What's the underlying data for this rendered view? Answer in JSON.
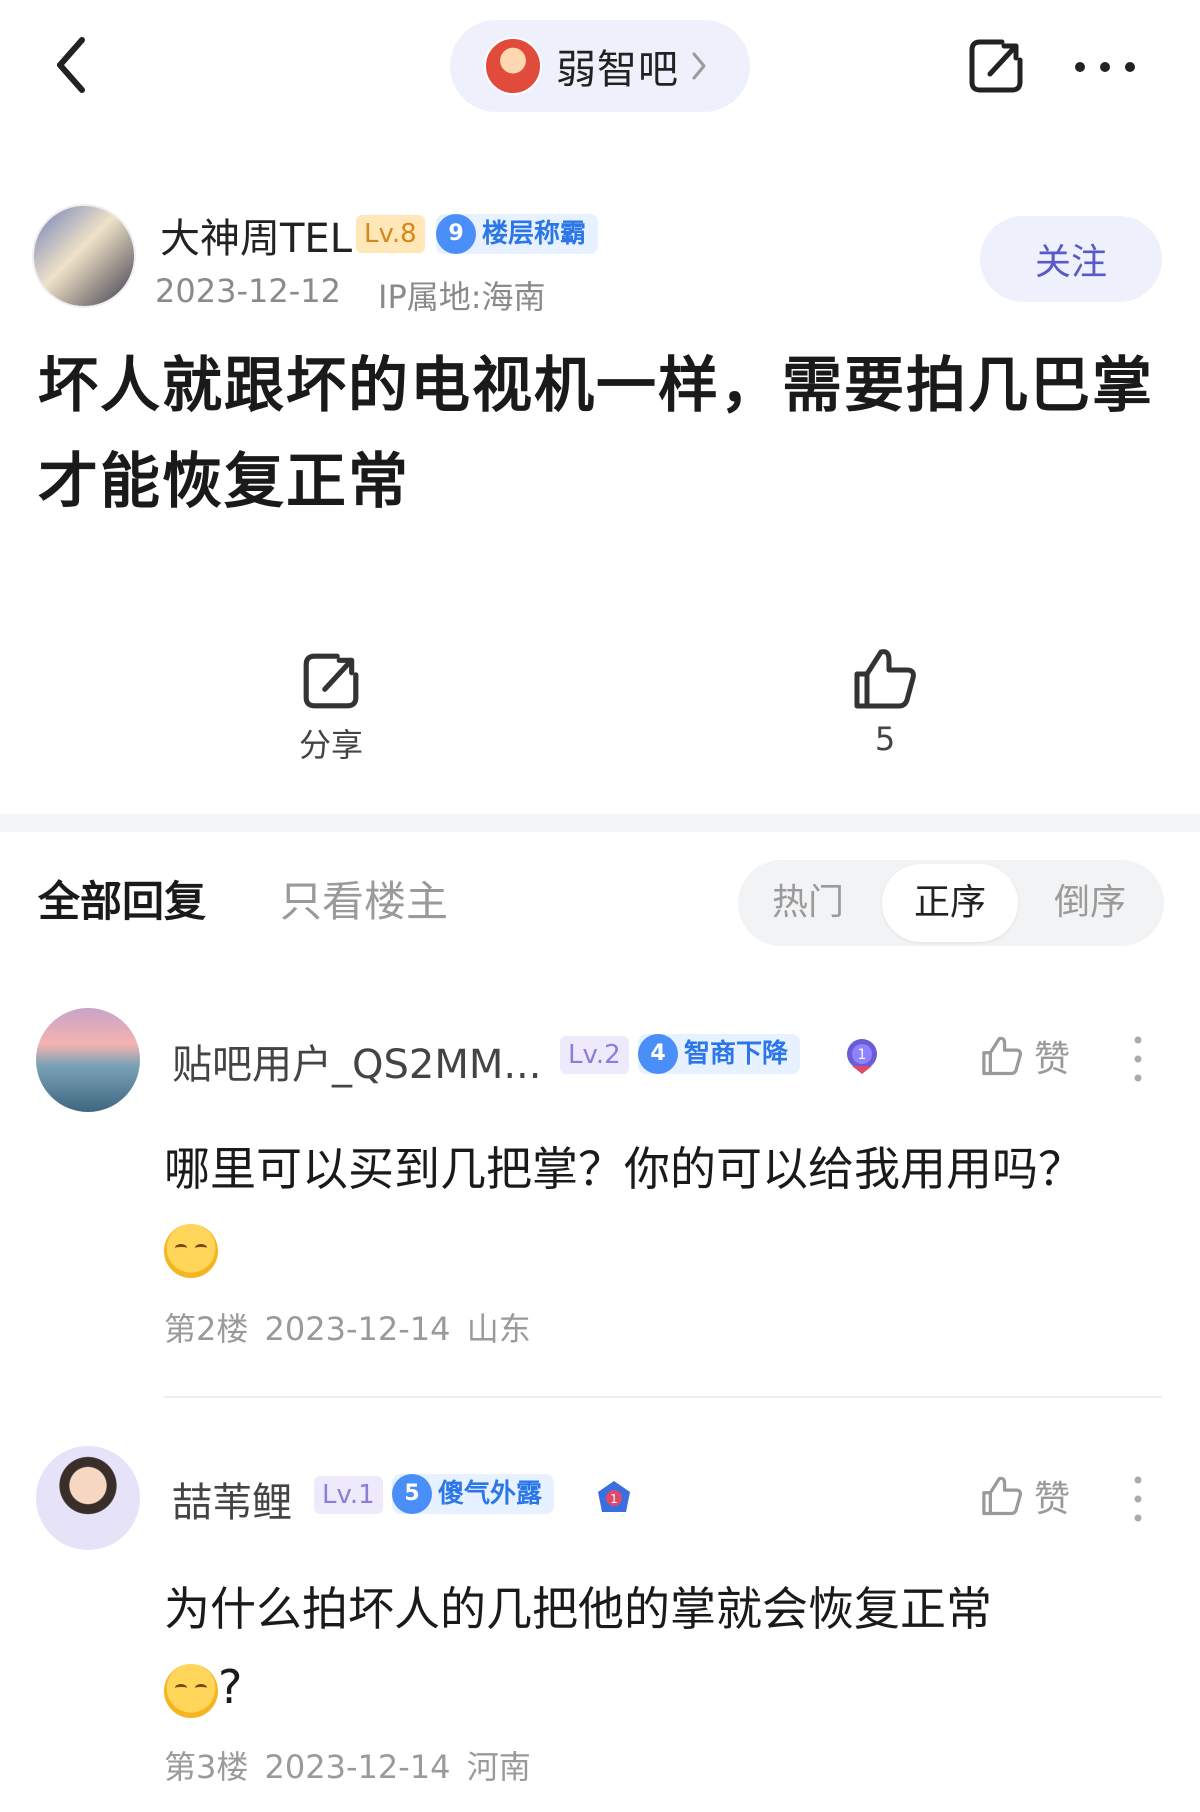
{
  "topbar": {
    "forum_name": "弱智吧",
    "icons": [
      "back-icon",
      "chevron-right-icon",
      "share-icon",
      "more-icon"
    ]
  },
  "post": {
    "author": {
      "name": "大神周TEL",
      "level": "Lv.8",
      "title_num": "9",
      "title": "楼层称霸"
    },
    "date": "2023-12-12",
    "ip": "IP属地:海南",
    "follow_label": "关注",
    "title": "坏人就跟坏的电视机一样，需要拍几巴掌才能恢复正常",
    "share_label": "分享",
    "like_count": "5"
  },
  "tabs": {
    "all": "全部回复",
    "op_only": "只看楼主",
    "sort": {
      "hot": "热门",
      "asc": "正序",
      "desc": "倒序",
      "selected": "正序"
    }
  },
  "replies": [
    {
      "name": "贴吧用户_QS2MM...",
      "level": "Lv.2",
      "title_num": "4",
      "title": "智商下降",
      "like_label": "赞",
      "text": "哪里可以买到几把掌？你的可以给我用用吗？",
      "emoji": "smiling-face-emoji",
      "floor": "第2楼",
      "date": "2023-12-14",
      "location": "山东"
    },
    {
      "name": "喆苇鲤",
      "level": "Lv.1",
      "title_num": "5",
      "title": "傻气外露",
      "like_label": "赞",
      "text": "为什么拍坏人的几把他的掌就会恢复正常",
      "emoji": "yum-face-emoji",
      "text_suffix": "?",
      "floor": "第3楼",
      "date": "2023-12-14",
      "location": "河南"
    }
  ],
  "colors": {
    "accent": "#5a59c9",
    "badge_blue": "#2b77ea",
    "level_gold": "#d6861c",
    "level_purple": "#8a7fd8"
  }
}
